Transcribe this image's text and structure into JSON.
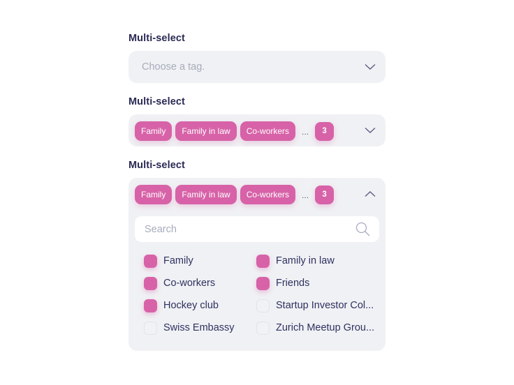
{
  "colors": {
    "accent": "#d762a8",
    "field_bg": "#f0f1f4",
    "label": "#2a2a55",
    "placeholder": "#a6acbb"
  },
  "selects": [
    {
      "label": "Multi-select",
      "state": "closed",
      "placeholder": "Choose a tag.",
      "chevron": "chevron-down-icon"
    },
    {
      "label": "Multi-select",
      "state": "closed",
      "chips": [
        "Family",
        "Family in law",
        "Co-workers"
      ],
      "overflow_indicator": "...",
      "overflow_count": "3",
      "chevron": "chevron-down-icon"
    },
    {
      "label": "Multi-select",
      "state": "open",
      "chips": [
        "Family",
        "Family in law",
        "Co-workers"
      ],
      "overflow_indicator": "...",
      "overflow_count": "3",
      "chevron": "chevron-up-icon",
      "search": {
        "placeholder": "Search",
        "value": "",
        "icon": "search-icon"
      },
      "options": [
        {
          "label": "Family",
          "checked": true
        },
        {
          "label": "Family in law",
          "checked": true
        },
        {
          "label": "Co-workers",
          "checked": true
        },
        {
          "label": "Friends",
          "checked": true
        },
        {
          "label": "Hockey club",
          "checked": true
        },
        {
          "label": "Startup Investor Col...",
          "checked": false
        },
        {
          "label": "Swiss Embassy",
          "checked": false
        },
        {
          "label": "Zurich Meetup Grou...",
          "checked": false
        }
      ]
    }
  ]
}
